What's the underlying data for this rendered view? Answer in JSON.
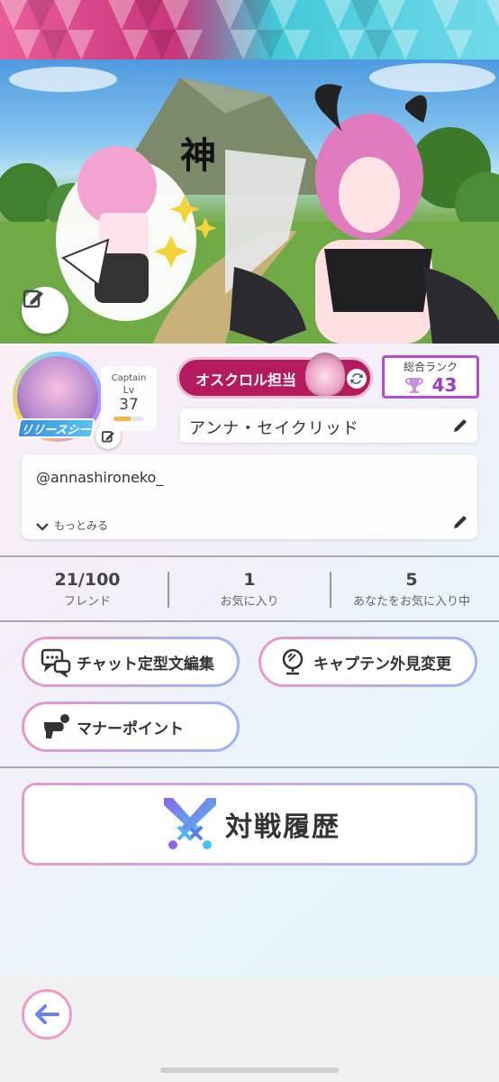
{
  "banner": {
    "kanji_text": "神"
  },
  "profile": {
    "release_badge": "リリースシー",
    "level_caption": "Captain",
    "level_label": "Lv",
    "level_value": "37",
    "level_progress": 0.55,
    "role_label": "オスクロル担当",
    "rank_title": "総合ランク",
    "rank_value": "43",
    "name": "アンナ・セイクリッド",
    "bio": "@annashironeko_",
    "more_label": "もっとみる"
  },
  "stats": [
    {
      "value": "21/100",
      "label": "フレンド"
    },
    {
      "value": "1",
      "label": "お気に入り"
    },
    {
      "value": "5",
      "label": "あなたをお気に入り中"
    }
  ],
  "menu": {
    "chat_label": "チャット定型文編集",
    "captain_label": "キャプテン外見変更",
    "manner_label": "マナーポイント",
    "battle_label": "対戦履歴"
  },
  "colors": {
    "role_pill": "#b61a5e",
    "rank_border": "#b24fd1",
    "button_gradient_start": "#e79acb",
    "button_gradient_end": "#9bb6f2",
    "back_arrow": "#6b7ff0"
  },
  "icons": {
    "banner_edit": "edit-icon",
    "avatar_edit": "edit-icon",
    "name_edit": "pencil-icon",
    "bio_edit": "pencil-icon",
    "more": "chevron-down-icon",
    "role_swap": "swap-icon",
    "rank": "trophy-icon",
    "chat": "chat-bubbles-icon",
    "captain": "mirror-icon",
    "manner": "whistle-icon",
    "battle": "crossed-swords-icon",
    "back": "arrow-left-icon"
  }
}
